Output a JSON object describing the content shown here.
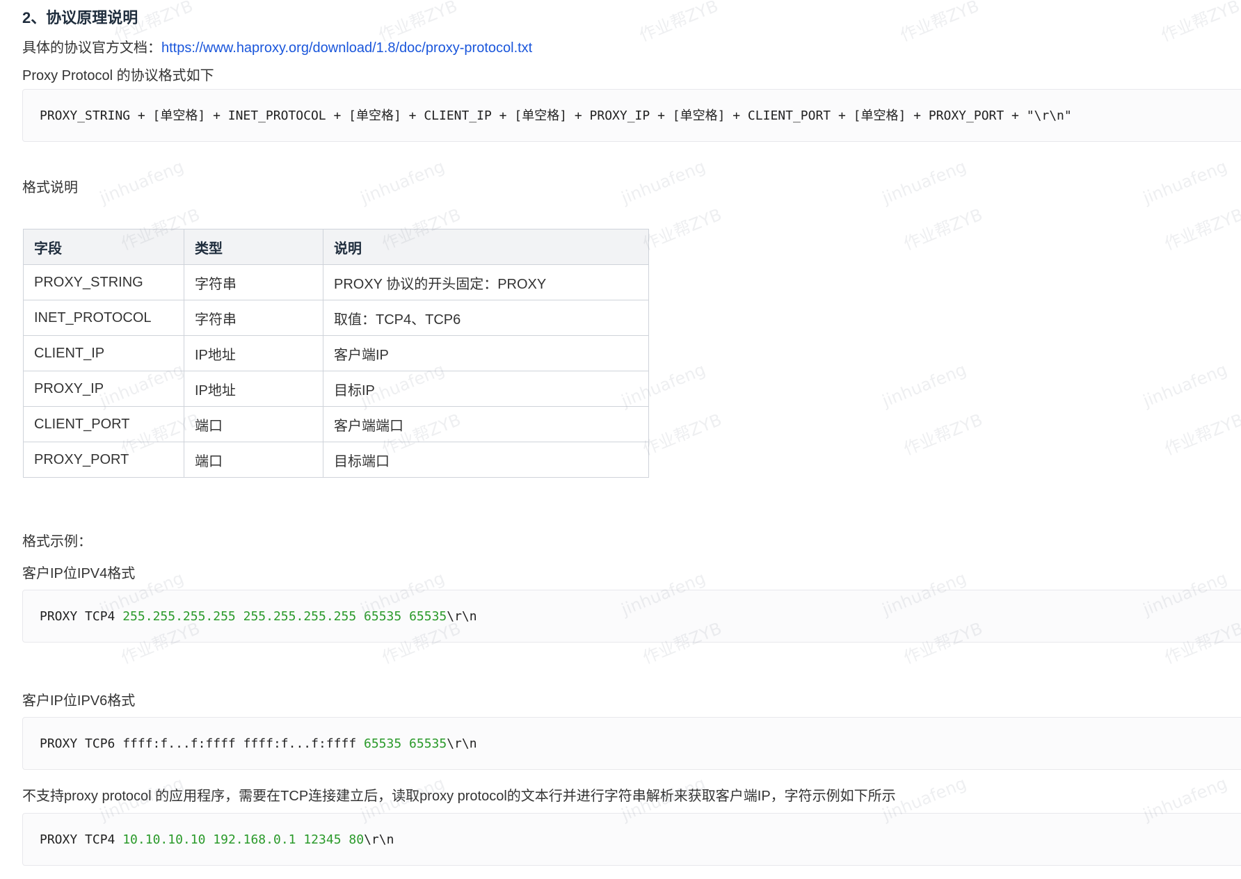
{
  "heading": "2、协议原理说明",
  "doc_link": {
    "prefix": "具体的协议官方文档：",
    "url_text": "https://www.haproxy.org/download/1.8/doc/proxy-protocol.txt"
  },
  "format_intro": "Proxy Protocol 的协议格式如下",
  "format_code": "PROXY_STRING + [单空格] + INET_PROTOCOL + [单空格] + CLIENT_IP + [单空格] + PROXY_IP + [单空格] + CLIENT_PORT + [单空格] + PROXY_PORT + \"\\r\\n\"",
  "table_title": "格式说明",
  "table": {
    "headers": [
      "字段",
      "类型",
      "说明"
    ],
    "rows": [
      [
        "PROXY_STRING",
        "字符串",
        "PROXY 协议的开头固定：PROXY"
      ],
      [
        "INET_PROTOCOL",
        "字符串",
        "取值：TCP4、TCP6"
      ],
      [
        "CLIENT_IP",
        "IP地址",
        "客户端IP"
      ],
      [
        "PROXY_IP",
        "IP地址",
        "目标IP"
      ],
      [
        "CLIENT_PORT",
        "端口",
        "客户端端口"
      ],
      [
        "PROXY_PORT",
        "端口",
        "目标端口"
      ]
    ]
  },
  "example_title": "格式示例：",
  "ipv4": {
    "label": "客户IP位IPV4格式",
    "code": {
      "keyword": "PROXY TCP4 ",
      "ip1": "255.255.255.255",
      "ip2": "255.255.255.255",
      "port1": "65535",
      "port2": "65535",
      "tail": "\\r\\n"
    }
  },
  "ipv6": {
    "label": "客户IP位IPV6格式",
    "code": {
      "keyword": "PROXY TCP6 ffff:f...f:ffff ffff:f...f:ffff ",
      "port1": "65535",
      "port2": "65535",
      "tail": "\\r\\n"
    }
  },
  "unsupported_note": "不支持proxy protocol 的应用程序，需要在TCP连接建立后，读取proxy protocol的文本行并进行字符串解析来获取客户端IP，字符示例如下所示",
  "sample": {
    "keyword": "PROXY TCP4 ",
    "ip1": "10.10.10.10",
    "ip2": "192.168.0.1",
    "port1": "12345",
    "port2": "80",
    "tail": "\\r\\n"
  },
  "watermarks": {
    "a": "作业帮ZYB",
    "b": "jinhuafeng"
  },
  "colors": {
    "link": "#1a56db",
    "code_number": "#2a9a2a",
    "table_border": "#cfd3da",
    "table_header_bg": "#f2f3f5"
  }
}
